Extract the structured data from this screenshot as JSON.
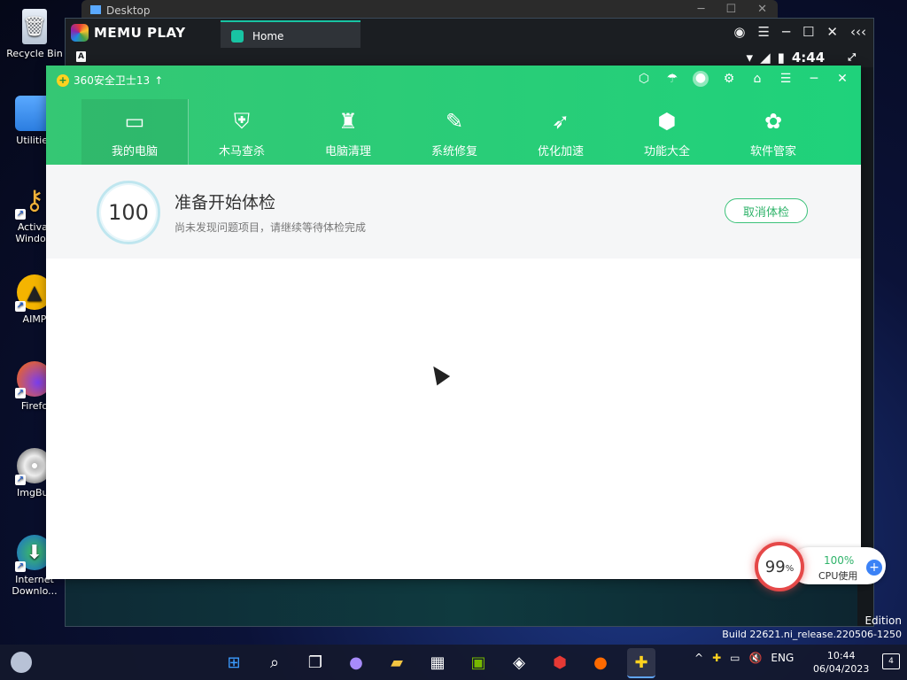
{
  "desktop": {
    "icons": [
      {
        "label": "Recycle Bin",
        "icon": "recycle-bin-icon"
      },
      {
        "label": "Utilities",
        "icon": "folder-icon"
      },
      {
        "label": "Activat\nWindow",
        "icon": "key-icon"
      },
      {
        "label": "AIMP",
        "icon": "aimp-icon"
      },
      {
        "label": "Firefo",
        "icon": "firefox-icon"
      },
      {
        "label": "ImgBur",
        "icon": "disc-icon"
      },
      {
        "label": "Internet\nDownlo...",
        "icon": "download-manager-icon"
      }
    ],
    "bg_window_title": "Desktop"
  },
  "memu": {
    "brand": "MEMU PLAY",
    "tab_label": "Home",
    "clock": "4:44"
  },
  "app": {
    "title": "360安全卫士13",
    "nav": [
      {
        "label": "我的电脑",
        "icon": "monitor-icon",
        "active": true
      },
      {
        "label": "木马查杀",
        "icon": "shield-bolt-icon"
      },
      {
        "label": "电脑清理",
        "icon": "broom-icon"
      },
      {
        "label": "系统修复",
        "icon": "wrench-icon"
      },
      {
        "label": "优化加速",
        "icon": "rocket-icon"
      },
      {
        "label": "功能大全",
        "icon": "cube-icon"
      },
      {
        "label": "软件管家",
        "icon": "grid-flower-icon"
      }
    ],
    "check": {
      "score": "100",
      "title": "准备开始体检",
      "subtitle": "尚未发现问题项目，请继续等待体检完成",
      "cancel_label": "取消体检"
    }
  },
  "cpu_widget": {
    "gauge_value": "99",
    "gauge_unit": "%",
    "percent": "100%",
    "label": "CPU使用"
  },
  "watermark": {
    "line1": "Edition",
    "line2": "Build 22621.ni_release.220506-1250"
  },
  "taskbar": {
    "language": "ENG",
    "time": "10:44",
    "date": "06/04/2023",
    "notification_count": "4"
  }
}
